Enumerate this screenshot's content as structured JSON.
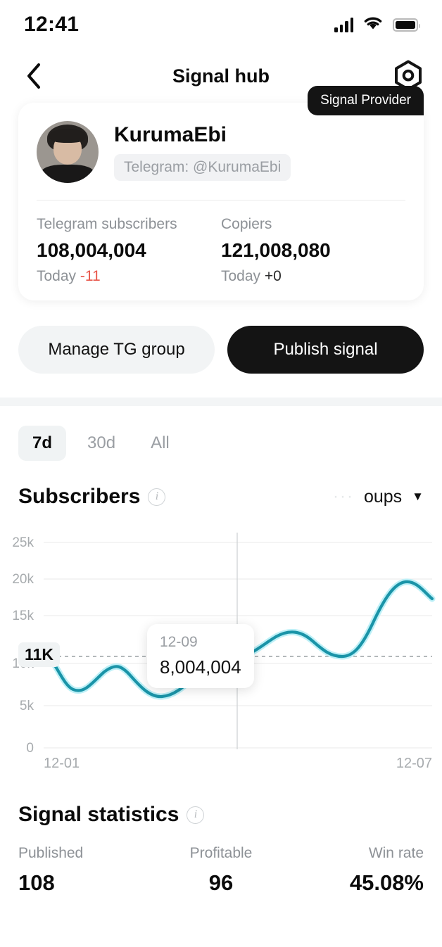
{
  "status_bar": {
    "time": "12:41",
    "signal_icon": "cellular-bars-icon",
    "wifi_icon": "wifi-icon",
    "battery_icon": "battery-full-icon"
  },
  "nav": {
    "back_icon": "chevron-left-icon",
    "title": "Signal hub",
    "settings_icon": "hex-gear-icon"
  },
  "profile": {
    "badge": "Signal Provider",
    "avatar": "user-avatar",
    "name": "KurumaEbi",
    "telegram_handle": "Telegram: @KurumaEbi",
    "stats": [
      {
        "label": "Telegram subscribers",
        "value": "108,004,004",
        "today_prefix": "Today",
        "today_delta": "-11",
        "delta_sign": "negative"
      },
      {
        "label": "Copiers",
        "value": "121,008,080",
        "today_prefix": "Today",
        "today_delta": "+0",
        "delta_sign": "zero"
      }
    ]
  },
  "actions": {
    "manage_label": "Manage TG group",
    "publish_label": "Publish signal"
  },
  "range_tabs": [
    {
      "label": "7d",
      "active": true
    },
    {
      "label": "30d",
      "active": false
    },
    {
      "label": "All",
      "active": false
    }
  ],
  "subscribers_section": {
    "title": "Subscribers",
    "info_icon": "info-circle-icon",
    "group_select_ghost": "···",
    "group_select_label": "oups",
    "caret_icon": "chevron-down-icon"
  },
  "chart_data": {
    "type": "line",
    "title": "Subscribers",
    "xlabel": "",
    "ylabel": "",
    "x_tick_labels": [
      "12-01",
      "12-07"
    ],
    "y_tick_labels": [
      "0",
      "5k",
      "10k",
      "15k",
      "20k",
      "25k"
    ],
    "ylim": [
      0,
      25000
    ],
    "grid": true,
    "legend": "none",
    "line_color": "#1a94a8",
    "series": [
      {
        "name": "Subscribers",
        "values": [
          11000,
          7000,
          9500,
          7400,
          11000,
          13000,
          11100,
          20000,
          19000
        ]
      }
    ],
    "highlight_label": "11K",
    "highlight_value": 11000,
    "tooltip": {
      "date": "12-09",
      "value": "8,004,004"
    }
  },
  "signal_statistics": {
    "title": "Signal statistics",
    "info_icon": "info-circle-icon",
    "items": [
      {
        "label": "Published",
        "value": "108"
      },
      {
        "label": "Profitable",
        "value": "96"
      },
      {
        "label": "Win rate",
        "value": "45.08%"
      }
    ]
  }
}
